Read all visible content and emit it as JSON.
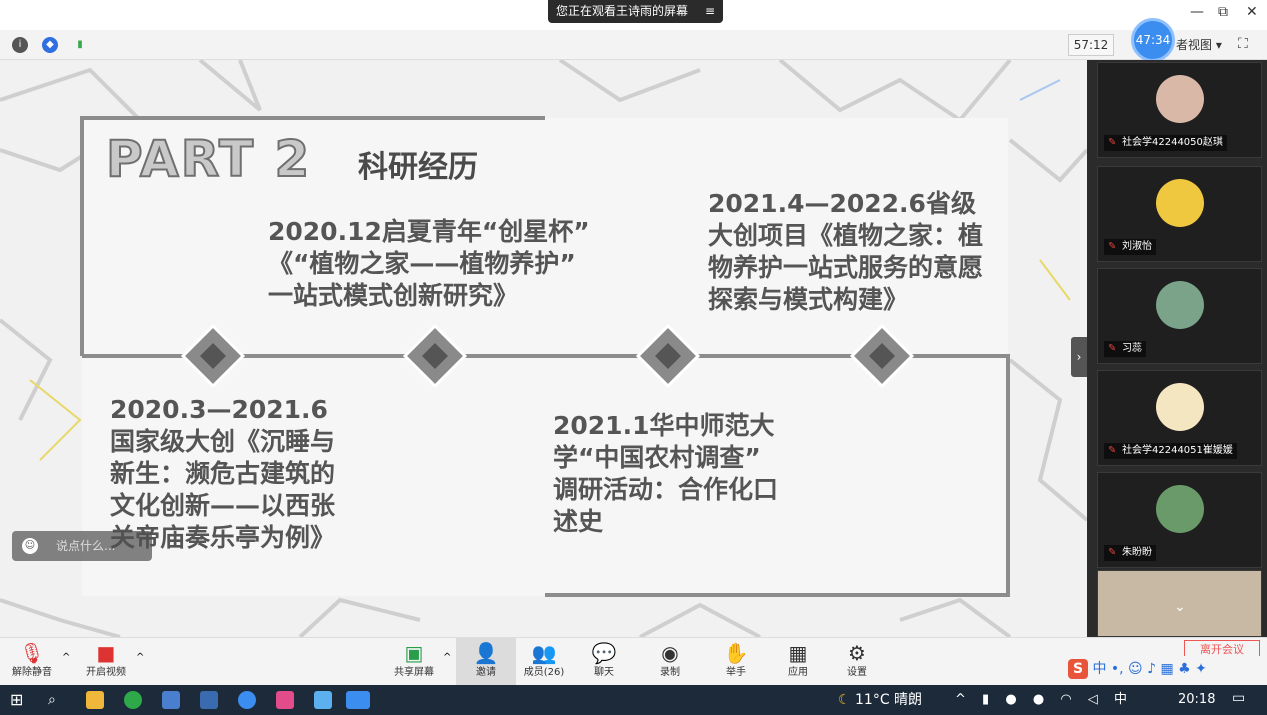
{
  "banner": {
    "text": "您正在观看王诗雨的屏幕",
    "menu_icon": "≡"
  },
  "top_bar": {
    "timer": "57:12",
    "bubble_time": "47:34",
    "view_label": "者视图 ▾"
  },
  "window_controls": {
    "minimize": "—",
    "restore": "⧉",
    "close": "✕"
  },
  "slide": {
    "part_title": "PART 2",
    "section_title": "科研经历",
    "events_top": [
      {
        "lines": [
          "2020.12启夏青年“创星杯”",
          "《“植物之家——植物养护”",
          "一站式模式创新研究》"
        ]
      },
      {
        "lines": [
          "2021.4—2022.6省级",
          "大创项目《植物之家：植",
          "物养护一站式服务的意愿",
          "探索与模式构建》"
        ]
      }
    ],
    "events_bottom": [
      {
        "lines": [
          "2020.3—2021.6",
          "国家级大创《沉睡与",
          "新生：濒危古建筑的",
          "文化创新——以西张",
          "关帝庙奏乐亭为例》"
        ]
      },
      {
        "lines": [
          "2021.1华中师范大",
          "学“中国农村调查”",
          "调研活动：合作化口",
          "述史"
        ]
      }
    ]
  },
  "chat": {
    "placeholder": "说点什么..."
  },
  "participants": [
    {
      "name": "社会学42244050赵琪",
      "color": "#d9b8a8"
    },
    {
      "name": "刘淑怡",
      "color": "#f0c840"
    },
    {
      "name": "习蕊",
      "color": "#7aa38a"
    },
    {
      "name": "社会学42244051崔媛媛",
      "color": "#f4e6c0"
    },
    {
      "name": "朱盼盼",
      "color": "#6a9a6a"
    }
  ],
  "toolbar": {
    "unmute": "解除静音",
    "start_video": "开启视频",
    "share_screen": "共享屏幕",
    "invite": "邀请",
    "members": "成员(26)",
    "chat": "聊天",
    "record": "录制",
    "raise_hand": "举手",
    "apps": "应用",
    "settings": "设置",
    "end_meeting": "离开会议"
  },
  "ime": "中 •, ☺ ♪ ▦ ♣ ✦",
  "taskbar": {
    "weather": "11°C 晴朗",
    "ime_lang": "中",
    "clock": "20:18"
  },
  "colors": {
    "accent": "#3b8df0",
    "timeline": "#8c8c8c",
    "text": "#555555"
  }
}
